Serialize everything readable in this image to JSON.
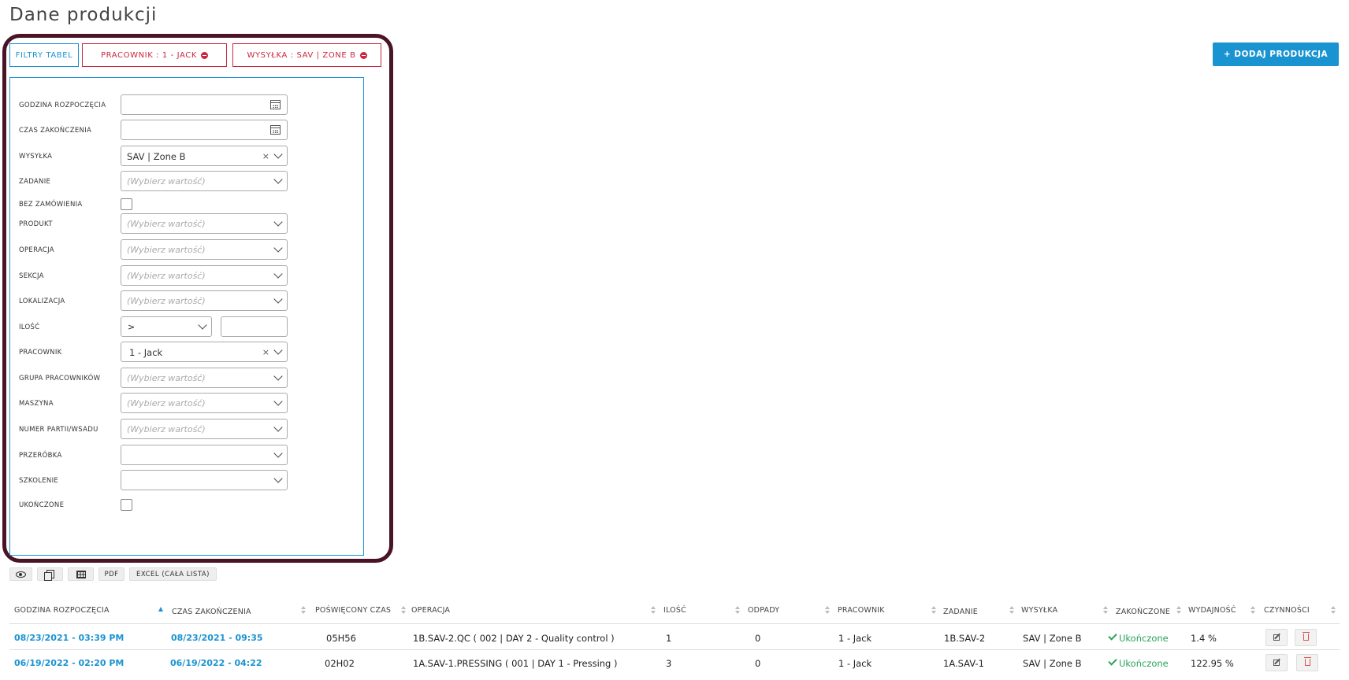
{
  "page": {
    "title": "Dane produkcji"
  },
  "filters": {
    "chips": {
      "table_filters": "FILTRY TABEL",
      "worker": "PRACOWNIK : 1 - JACK",
      "shipping": "WYSYŁKA : SAV | ZONE B"
    },
    "fields": {
      "start_time": {
        "label": "GODZINA ROZPOCZĘCIA"
      },
      "end_time": {
        "label": "CZAS ZAKOŃCZENIA"
      },
      "shipping": {
        "label": "WYSYŁKA",
        "value": "SAV | Zone B",
        "clear": "×"
      },
      "task": {
        "label": "ZADANIE",
        "placeholder": "(Wybierz wartość)"
      },
      "no_order": {
        "label": "BEZ ZAMÓWIENIA"
      },
      "product": {
        "label": "PRODUKT",
        "placeholder": "(Wybierz wartość)"
      },
      "operation": {
        "label": "OPERACJA",
        "placeholder": "(Wybierz wartość)"
      },
      "section": {
        "label": "SEKCJA",
        "placeholder": "(Wybierz wartość)"
      },
      "location": {
        "label": "LOKALIZACJA",
        "placeholder": "(Wybierz wartość)"
      },
      "quantity": {
        "label": "ILOŚĆ",
        "operator": ">"
      },
      "worker": {
        "label": "PRACOWNIK",
        "value": "1 - Jack",
        "clear": "×"
      },
      "worker_group": {
        "label": "GRUPA PRACOWNIKÓW",
        "placeholder": "(Wybierz wartość)"
      },
      "machine": {
        "label": "MASZYNA",
        "placeholder": "(Wybierz wartość)"
      },
      "batch": {
        "label": "NUMER PARTII/WSADU",
        "placeholder": "(Wybierz wartość)"
      },
      "rework": {
        "label": "PRZERÓBKA"
      },
      "training": {
        "label": "SZKOLENIE"
      },
      "completed": {
        "label": "UKOŃCZONE"
      }
    }
  },
  "header_actions": {
    "add_button": "+ DODAJ PRODUKCJA"
  },
  "toolbar": {
    "pdf": "PDF",
    "excel": "EXCEL (CAŁA LISTA)",
    "icons": [
      "eye-icon",
      "copy-icon",
      "grid-icon"
    ]
  },
  "table": {
    "columns": [
      "GODZINA ROZPOCZĘCIA",
      "CZAS ZAKOŃCZENIA",
      "POŚWIĘCONY CZAS",
      "OPERACJA",
      "ILOŚĆ",
      "ODPADY",
      "PRACOWNIK",
      "ZADANIE",
      "WYSYŁKA",
      "ZAKOŃCZONE",
      "WYDAJNOŚĆ",
      "CZYNNOŚCI"
    ],
    "rows": [
      {
        "start": "08/23/2021 - 03:39 PM",
        "end": "08/23/2021 - 09:35 PM",
        "duration": "05H56",
        "operation": "1B.SAV-2.QC ( 002 | DAY 2 - Quality control )",
        "qty": "1",
        "waste": "0",
        "worker": "1 - Jack",
        "task": "1B.SAV-2",
        "shipping": "SAV | Zone B",
        "completed": "Ukończone",
        "efficiency": "1.4 %"
      },
      {
        "start": "06/19/2022 - 02:20 PM",
        "end": "06/19/2022 - 04:22 PM",
        "duration": "02H02",
        "operation": "1A.SAV-1.PRESSING ( 001 | DAY 1 - Pressing )",
        "qty": "3",
        "waste": "0",
        "worker": "1 - Jack",
        "task": "1A.SAV-1",
        "shipping": "SAV | Zone B",
        "completed": "Ukończone",
        "efficiency": "122.95 %"
      }
    ]
  },
  "colors": {
    "accent": "#1a93d1",
    "danger": "#c9283e",
    "success": "#27a35a",
    "highlight": "#4a1426"
  }
}
